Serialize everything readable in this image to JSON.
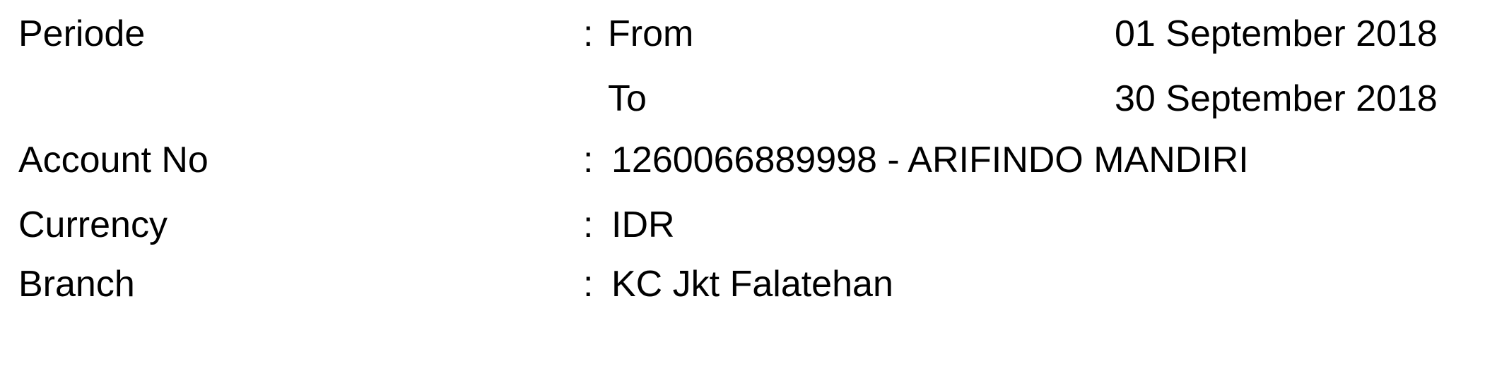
{
  "colon": ":",
  "periode": {
    "label": "Periode",
    "from_label": "From",
    "from_date": "01 September 2018",
    "to_label": "To",
    "to_date": "30 September 2018"
  },
  "account": {
    "label": "Account No",
    "value": "1260066889998 - ARIFINDO MANDIRI"
  },
  "currency": {
    "label": "Currency",
    "value": "IDR"
  },
  "branch": {
    "label": "Branch",
    "value": "KC Jkt Falatehan"
  }
}
